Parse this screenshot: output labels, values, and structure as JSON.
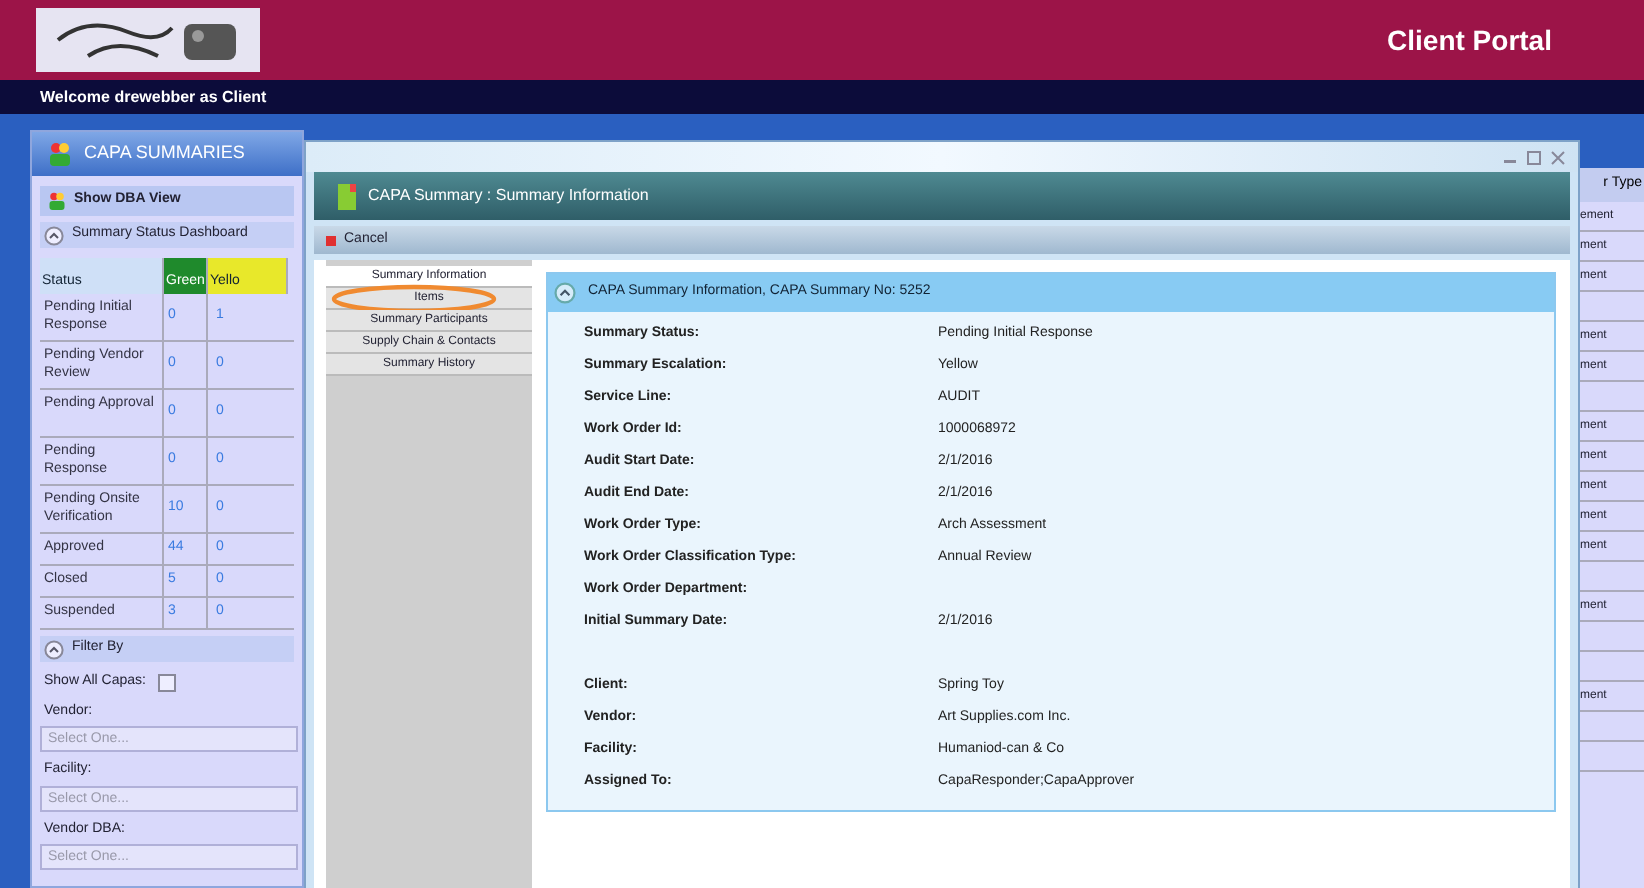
{
  "header": {
    "title": "Client Portal",
    "welcome": "Welcome drewebber as Client"
  },
  "left_panel": {
    "title": "CAPA SUMMARIES",
    "dba_view": "Show DBA View",
    "dashboard_title": "Summary Status Dashboard",
    "columns": [
      {
        "label": "Status",
        "color": "#cfe0f7"
      },
      {
        "label": "Green",
        "color": "#1f8a2c"
      },
      {
        "label": "Yello",
        "color": "#e8e82a"
      }
    ],
    "rows": [
      {
        "status": "Pending Initial Response",
        "green": "0",
        "yellow": "1"
      },
      {
        "status": "Pending Vendor Review",
        "green": "0",
        "yellow": "0"
      },
      {
        "status": "Pending Approval",
        "green": "0",
        "yellow": "0"
      },
      {
        "status": "Pending Response",
        "green": "0",
        "yellow": "0"
      },
      {
        "status": "Pending Onsite Verification",
        "green": "10",
        "yellow": "0"
      },
      {
        "status": "Approved",
        "green": "44",
        "yellow": "0"
      },
      {
        "status": "Closed",
        "green": "5",
        "yellow": "0"
      },
      {
        "status": "Suspended",
        "green": "3",
        "yellow": "0"
      }
    ],
    "filter": {
      "title": "Filter By",
      "show_all_label": "Show All Capas:",
      "show_all_checked": false,
      "fields": [
        {
          "label": "Vendor:",
          "placeholder": "Select One..."
        },
        {
          "label": "Facility:",
          "placeholder": "Select One..."
        },
        {
          "label": "Vendor DBA:",
          "placeholder": "Select One..."
        }
      ]
    }
  },
  "background_table": {
    "header": "r Type",
    "cells": [
      "ement",
      "ment",
      "ment",
      "",
      "ment",
      "ment",
      "",
      "ment",
      "ment",
      "ment",
      "ment",
      "ment",
      "",
      "ment",
      "",
      "",
      "ment",
      "",
      ""
    ]
  },
  "dialog": {
    "title": "CAPA Summary : Summary Information",
    "cancel": "Cancel",
    "nav": [
      {
        "label": "Summary Information",
        "selected": true,
        "highlighted": false
      },
      {
        "label": "Items",
        "selected": false,
        "highlighted": true
      },
      {
        "label": "Summary Participants",
        "selected": false,
        "highlighted": false
      },
      {
        "label": "Supply Chain & Contacts",
        "selected": false,
        "highlighted": false
      },
      {
        "label": "Summary History",
        "selected": false,
        "highlighted": false
      }
    ],
    "panel_title": "CAPA Summary Information, CAPA Summary No: 5252",
    "fields": [
      {
        "label": "Summary Status:",
        "value": "Pending Initial Response"
      },
      {
        "label": "Summary Escalation:",
        "value": "Yellow"
      },
      {
        "label": "Service Line:",
        "value": "AUDIT"
      },
      {
        "label": "Work Order Id:",
        "value": "1000068972"
      },
      {
        "label": "Audit Start Date:",
        "value": "2/1/2016"
      },
      {
        "label": "Audit End Date:",
        "value": "2/1/2016"
      },
      {
        "label": "Work Order Type:",
        "value": "Arch Assessment"
      },
      {
        "label": "Work Order Classification Type:",
        "value": "Annual Review"
      },
      {
        "label": "Work Order Department:"
      },
      {
        "label": "Initial Summary Date:",
        "value": "2/1/2016"
      }
    ],
    "party_fields": [
      {
        "label": "Client:",
        "value": "Spring Toy"
      },
      {
        "label": "Vendor:",
        "value": "Art Supplies.com Inc."
      },
      {
        "label": "Facility:",
        "value": "Humaniod-can & Co"
      },
      {
        "label": "Assigned To:",
        "value": "CapaResponder;CapaApprover"
      }
    ]
  }
}
